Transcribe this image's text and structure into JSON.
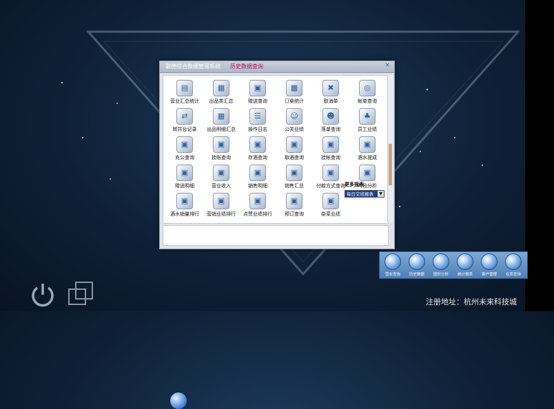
{
  "dialog": {
    "app_title": "歌德综合数据管理系统",
    "subtitle": "历史数据查询",
    "close": "×"
  },
  "grid": [
    {
      "label": "营业汇总统计",
      "icon": "report-icon"
    },
    {
      "label": "出品类汇总",
      "icon": "chart-icon"
    },
    {
      "label": "赠送查询",
      "icon": "doc-icon"
    },
    {
      "label": "订桌统计",
      "icon": "calendar-icon"
    },
    {
      "label": "取消单",
      "icon": "cancel-icon"
    },
    {
      "label": "帐单查询",
      "icon": "search-icon"
    },
    {
      "label": "转并台记录",
      "icon": "transfer-icon"
    },
    {
      "label": "出品明细汇总",
      "icon": "chart-icon"
    },
    {
      "label": "操作日志",
      "icon": "log-icon"
    },
    {
      "label": "公关业绩",
      "icon": "person-icon"
    },
    {
      "label": "落单查询",
      "icon": "smile-icon"
    },
    {
      "label": "员工业绩",
      "icon": "users-icon"
    },
    {
      "label": "充公查询",
      "icon": "doc-icon"
    },
    {
      "label": "挂账查询",
      "icon": "doc-icon"
    },
    {
      "label": "存酒查询",
      "icon": "doc-icon"
    },
    {
      "label": "取酒查询",
      "icon": "doc-icon"
    },
    {
      "label": "挂帐查询",
      "icon": "doc-icon"
    },
    {
      "label": "酒水提成",
      "icon": "doc-icon"
    },
    {
      "label": "赠送明细",
      "icon": "doc-icon"
    },
    {
      "label": "营业收入",
      "icon": "doc-icon"
    },
    {
      "label": "销售明细",
      "icon": "doc-icon"
    },
    {
      "label": "销售汇总",
      "icon": "doc-icon"
    },
    {
      "label": "付款方式查询",
      "icon": "doc-icon"
    },
    {
      "label": "时段分析",
      "icon": "doc-icon"
    },
    {
      "label": "酒水销量排行",
      "icon": "doc-icon"
    },
    {
      "label": "营销业绩排行",
      "icon": "doc-icon"
    },
    {
      "label": "点赞业绩排行",
      "icon": "doc-icon"
    },
    {
      "label": "预订查询",
      "icon": "doc-icon"
    },
    {
      "label": "杂菜业绩",
      "icon": "doc-icon"
    }
  ],
  "more_reports": {
    "label": "更多报表",
    "selected": "每日交班报表"
  },
  "taskbar": [
    {
      "label": "营业查询",
      "icon": "query-icon"
    },
    {
      "label": "历史数据",
      "icon": "history-icon"
    },
    {
      "label": "图形分析",
      "icon": "graph-icon"
    },
    {
      "label": "统计报表",
      "icon": "report-icon"
    },
    {
      "label": "客户管理",
      "icon": "customer-icon"
    },
    {
      "label": "在库查询",
      "icon": "inventory-icon"
    }
  ],
  "footer": "注册地址：杭州未来科技城"
}
